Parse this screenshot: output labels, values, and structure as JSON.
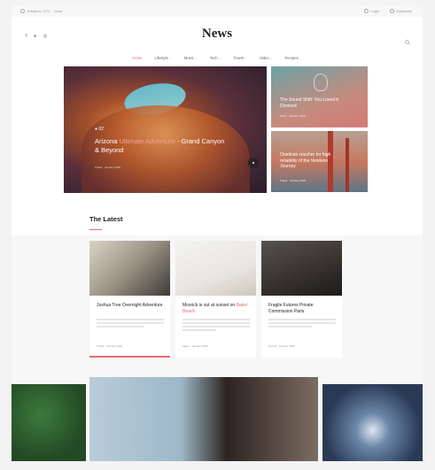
{
  "util": {
    "left_text": "Weather: 22°C · Clear",
    "right_links": [
      "Login",
      "Subscribe"
    ]
  },
  "header": {
    "logo": "News",
    "socials": [
      "f",
      "♦",
      "◎"
    ]
  },
  "nav": {
    "items": [
      "Home",
      "Lifestyle",
      "Music",
      "Tech",
      "Travel",
      "Video",
      "Recipes"
    ]
  },
  "hero": {
    "number": "02",
    "title_part1": "Arizona ",
    "title_highlight": "Ultimate Adventure",
    "title_part2": " - Grand Canyon & Beyond",
    "meta": "Travel · January 2020"
  },
  "side_cards": [
    {
      "title": "The Sound Shift: You Loved it Dimmed",
      "meta": "Music · January 2020"
    },
    {
      "title": "Onetlook voucher for high reliability of the Veniteon Journey",
      "meta": "Travel · January 2020"
    }
  ],
  "section": {
    "title": "The Latest"
  },
  "cards": [
    {
      "title": "Joshua Tree Overnight Adventure",
      "highlight": "",
      "meta": "Travel · January 2020"
    },
    {
      "title": "Mosrick is out at sunset on ",
      "highlight": "Baker Beach",
      "meta": "Video · January 2020"
    },
    {
      "title": "Fragile Futures Private Commission Paris",
      "highlight": "",
      "meta": "Events · January 2020"
    }
  ]
}
